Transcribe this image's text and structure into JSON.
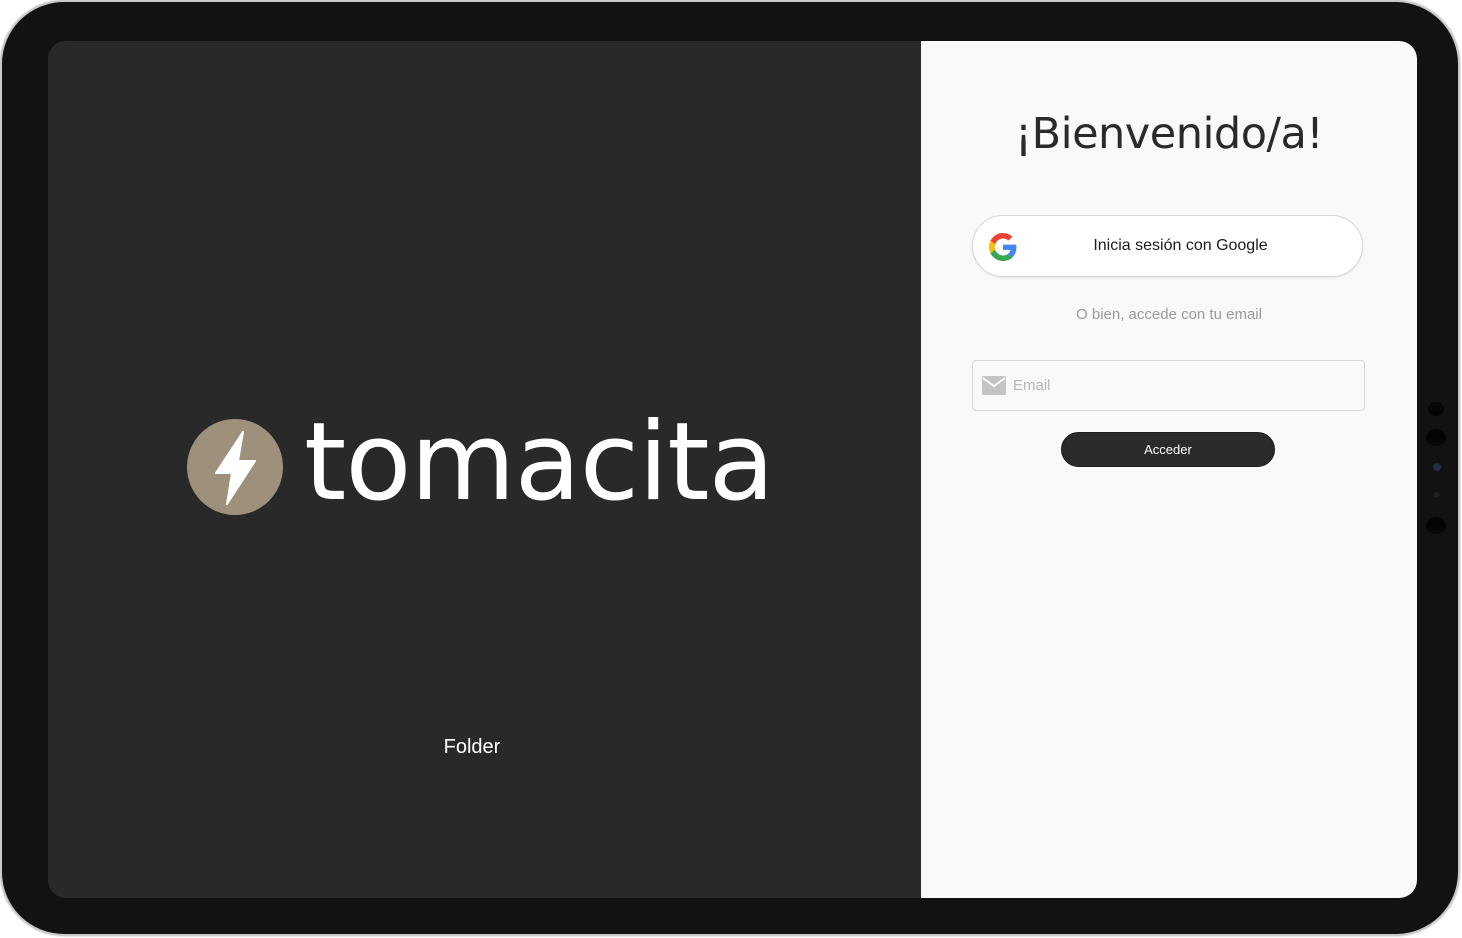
{
  "brand": {
    "name": "tomacita",
    "logo_color": "#9d917c",
    "icon": "lightning-bolt-icon"
  },
  "left_panel": {
    "footer_label": "Folder",
    "background": "#292929"
  },
  "login": {
    "title": "¡Bienvenido/a!",
    "google_button_label": "Inicia sesión con Google",
    "divider_text": "O bien, accede con tu email",
    "email_placeholder": "Email",
    "email_value": "",
    "submit_label": "Acceder",
    "background": "#f9f9f9",
    "button_color": "#2b2b2b"
  }
}
